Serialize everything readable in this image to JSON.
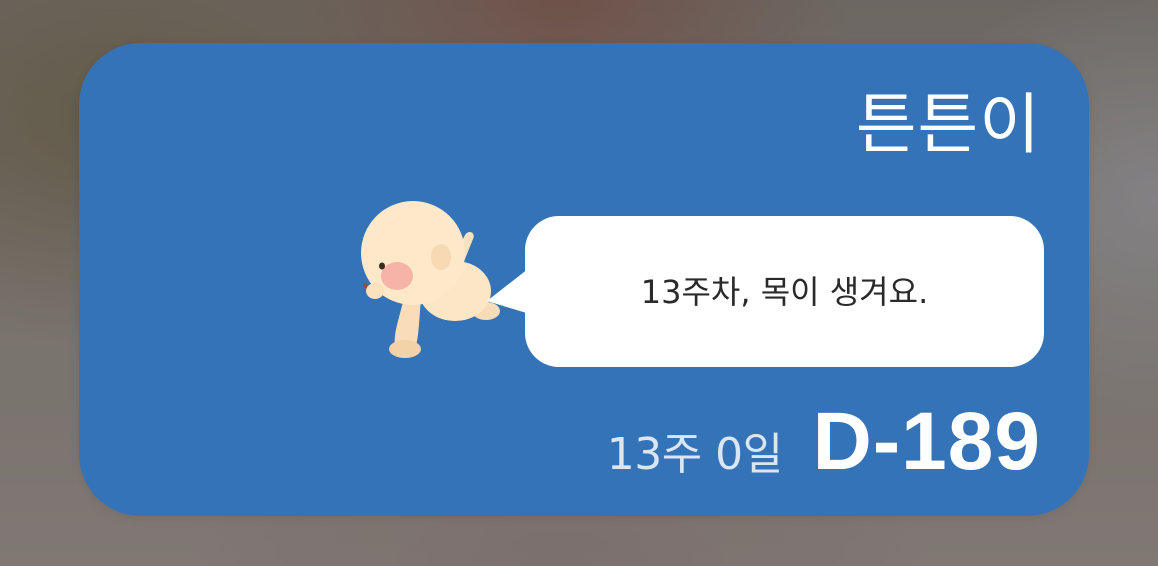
{
  "widget": {
    "background_color": "#3573b9",
    "baby_name": "튼튼이",
    "baby_illustration_icon": "crawling-baby-icon",
    "message": "13주차, 목이 생겨요.",
    "pregnancy_week_day": "13주 0일",
    "d_day": "D-189"
  }
}
